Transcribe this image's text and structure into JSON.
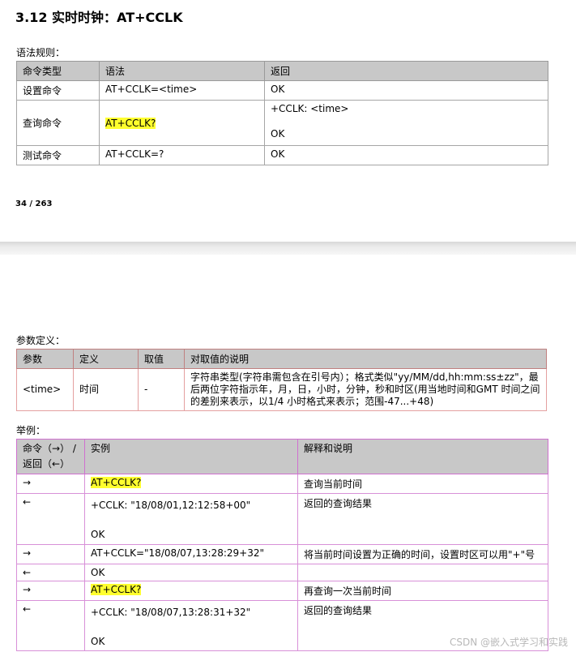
{
  "page1": {
    "title": "3.12 实时时钟：AT+CCLK",
    "syntax_label": "语法规则：",
    "syntax_headers": [
      "命令类型",
      "语法",
      "返回"
    ],
    "syntax_rows": [
      {
        "type": "设置命令",
        "syntax": "AT+CCLK=<time>",
        "ret1": "OK",
        "ret2": ""
      },
      {
        "type": "查询命令",
        "syntax": "AT+CCLK?",
        "ret1": "+CCLK: <time>",
        "ret2": "OK"
      },
      {
        "type": "测试命令",
        "syntax": "AT+CCLK=?",
        "ret1": "OK",
        "ret2": ""
      }
    ],
    "page_number": "34 / 263"
  },
  "page2": {
    "param_label": "参数定义：",
    "param_headers": [
      "参数",
      "定义",
      "取值",
      "对取值的说明"
    ],
    "param_row": {
      "name": "<time>",
      "def": "时间",
      "value": "-",
      "desc": "字符串类型(字符串需包含在引号内）；格式类似\"yy/MM/dd,hh:mm:ss±zz\"，最后两位字符指示年，月，日，小时，分钟，秒和时区(用当地时间和GMT 时间之间的差别来表示，以1/4  小时格式来表示；范围-47...+48)"
    },
    "example_label": "举例：",
    "example_headers": {
      "cmd_line1": "命令（→）  /",
      "cmd_line2": "返回（←）",
      "example": "实例",
      "explain": "解释和说明"
    },
    "example_rows": [
      {
        "dir": "→",
        "l1": "AT+CCLK?",
        "l2": "",
        "note": "查询当前时间"
      },
      {
        "dir": "←",
        "l1": "+CCLK: \"18/08/01,12:12:58+00\"",
        "l2": "OK",
        "note": "返回的查询结果"
      },
      {
        "dir": "→",
        "l1": "AT+CCLK=\"18/08/07,13:28:29+32\"",
        "l2": "",
        "note": "将当前时间设置为正确的时间，设置时区可以用\"+\"号"
      },
      {
        "dir": "←",
        "l1": "OK",
        "l2": "",
        "note": ""
      },
      {
        "dir": "→",
        "l1": "AT+CCLK?",
        "l2": "",
        "note": "再查询一次当前时间"
      },
      {
        "dir": "←",
        "l1": "+CCLK: \"18/08/07,13:28:31+32\"",
        "l2": "OK",
        "note": "返回的查询结果"
      }
    ],
    "watermark": "CSDN @嵌入式学习和实践"
  }
}
